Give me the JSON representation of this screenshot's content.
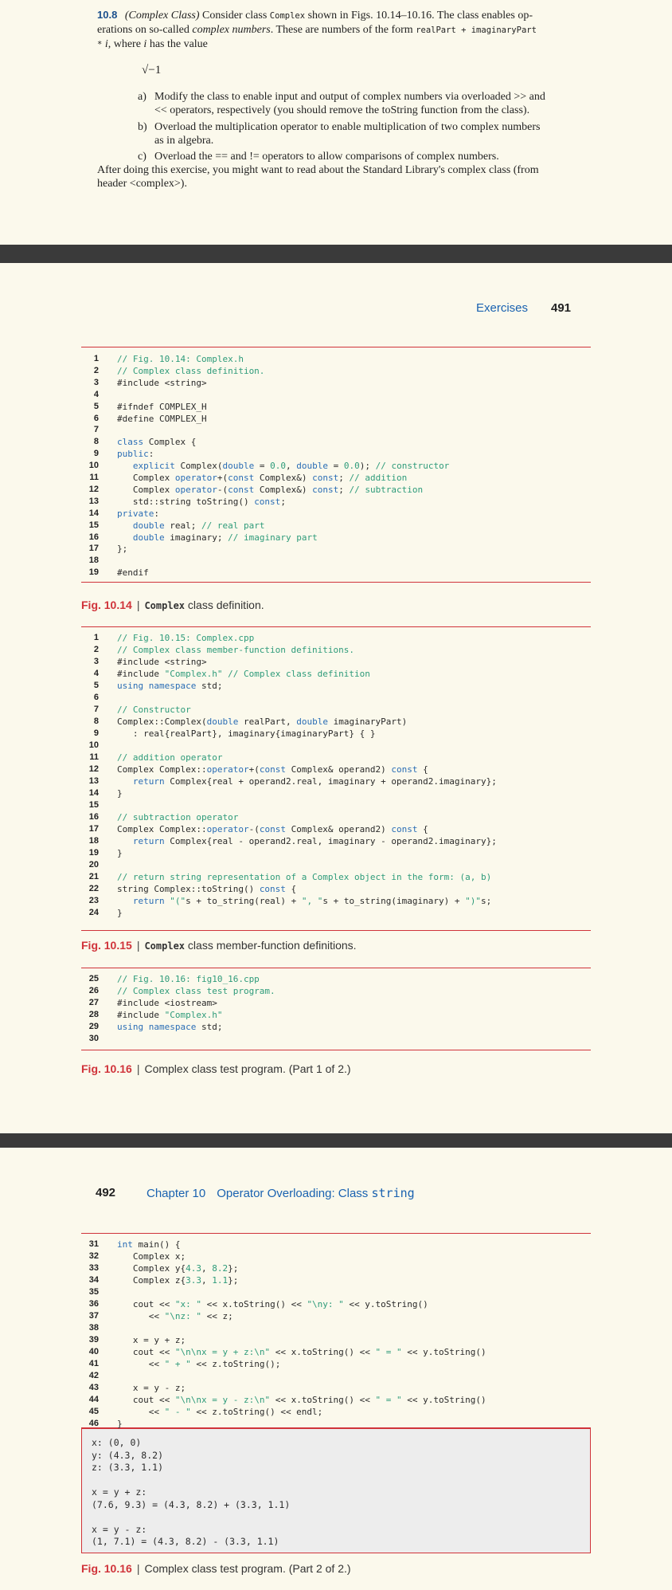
{
  "exercise": {
    "number": "10.8",
    "title": "(Complex Class)",
    "intro_a": " Consider class ",
    "intro_code": "Complex",
    "intro_b": " shown in Figs. 10.14–10.16. The class enables op-",
    "line2_a": "erations on so-called ",
    "line2_em": "complex numbers",
    "line2_b": ". These are numbers of the form ",
    "line2_code": "realPart + imaginaryPart",
    "line3_code": "*",
    "line3_a": " ",
    "line3_i": "i",
    "line3_b": ", where ",
    "line3_i2": "i",
    "line3_c": " has the value",
    "sqrt": "√−1",
    "item_a_label": "a)",
    "item_a_1": "Modify the class to enable input and output of complex numbers via overloaded >> and",
    "item_a_2": "<< operators, respectively (you should remove the toString function from the class).",
    "item_b_label": "b)",
    "item_b_1": "Overload the multiplication operator to enable multiplication of two complex numbers",
    "item_b_2": "as in algebra.",
    "item_c_label": "c)",
    "item_c": "Overload the == and != operators to allow comparisons of complex numbers.",
    "after_1": "After doing this exercise, you might want to read about the Standard Library's complex class (from",
    "after_2": "header <complex>)."
  },
  "page2": {
    "header_section": "Exercises",
    "header_page": "491"
  },
  "page3": {
    "header_page": "492",
    "header_chapter": "Chapter 10",
    "header_title": "Operator Overloading: Class ",
    "header_title_code": "string"
  },
  "fig1014": {
    "lines": [
      {
        "n": "1",
        "t": "// Fig. 10.14: Complex.h"
      },
      {
        "n": "2",
        "t": "// Complex class definition."
      },
      {
        "n": "3",
        "t": "#include <string>"
      },
      {
        "n": "4",
        "t": ""
      },
      {
        "n": "5",
        "t": "#ifndef COMPLEX_H"
      },
      {
        "n": "6",
        "t": "#define COMPLEX_H"
      },
      {
        "n": "7",
        "t": ""
      },
      {
        "n": "8",
        "t": "class Complex {"
      },
      {
        "n": "9",
        "t": "public:"
      },
      {
        "n": "10",
        "t": "   explicit Complex(double = 0.0, double = 0.0); // constructor"
      },
      {
        "n": "11",
        "t": "   Complex operator+(const Complex&) const; // addition"
      },
      {
        "n": "12",
        "t": "   Complex operator-(const Complex&) const; // subtraction"
      },
      {
        "n": "13",
        "t": "   std::string toString() const;"
      },
      {
        "n": "14",
        "t": "private:"
      },
      {
        "n": "15",
        "t": "   double real; // real part"
      },
      {
        "n": "16",
        "t": "   double imaginary; // imaginary part"
      },
      {
        "n": "17",
        "t": "};"
      },
      {
        "n": "18",
        "t": ""
      },
      {
        "n": "19",
        "t": "#endif"
      }
    ],
    "cap_fig": "Fig. 10.14",
    "cap_code": "Complex",
    "cap_text": " class definition."
  },
  "fig1015": {
    "lines": [
      {
        "n": "1",
        "t": "// Fig. 10.15: Complex.cpp"
      },
      {
        "n": "2",
        "t": "// Complex class member-function definitions."
      },
      {
        "n": "3",
        "t": "#include <string>"
      },
      {
        "n": "4",
        "t": "#include \"Complex.h\" // Complex class definition"
      },
      {
        "n": "5",
        "t": "using namespace std;"
      },
      {
        "n": "6",
        "t": ""
      },
      {
        "n": "7",
        "t": "// Constructor"
      },
      {
        "n": "8",
        "t": "Complex::Complex(double realPart, double imaginaryPart)"
      },
      {
        "n": "9",
        "t": "   : real{realPart}, imaginary{imaginaryPart} { }"
      },
      {
        "n": "10",
        "t": ""
      },
      {
        "n": "11",
        "t": "// addition operator"
      },
      {
        "n": "12",
        "t": "Complex Complex::operator+(const Complex& operand2) const {"
      },
      {
        "n": "13",
        "t": "   return Complex{real + operand2.real, imaginary + operand2.imaginary};"
      },
      {
        "n": "14",
        "t": "}"
      },
      {
        "n": "15",
        "t": ""
      },
      {
        "n": "16",
        "t": "// subtraction operator"
      },
      {
        "n": "17",
        "t": "Complex Complex::operator-(const Complex& operand2) const {"
      },
      {
        "n": "18",
        "t": "   return Complex{real - operand2.real, imaginary - operand2.imaginary};"
      },
      {
        "n": "19",
        "t": "}"
      },
      {
        "n": "20",
        "t": ""
      },
      {
        "n": "21",
        "t": "// return string representation of a Complex object in the form: (a, b)"
      },
      {
        "n": "22",
        "t": "string Complex::toString() const {"
      },
      {
        "n": "23",
        "t": "   return \"(\"s + to_string(real) + \", \"s + to_string(imaginary) + \")\"s;"
      },
      {
        "n": "24",
        "t": "}"
      }
    ],
    "cap_fig": "Fig. 10.15",
    "cap_code": "Complex",
    "cap_text": " class member-function definitions."
  },
  "fig1016a": {
    "lines": [
      {
        "n": "25",
        "t": "// Fig. 10.16: fig10_16.cpp"
      },
      {
        "n": "26",
        "t": "// Complex class test program."
      },
      {
        "n": "27",
        "t": "#include <iostream>"
      },
      {
        "n": "28",
        "t": "#include \"Complex.h\""
      },
      {
        "n": "29",
        "t": "using namespace std;"
      },
      {
        "n": "30",
        "t": ""
      }
    ],
    "cap_fig": "Fig. 10.16",
    "cap_text": "Complex class test program. (Part 1 of 2.)"
  },
  "fig1016b": {
    "lines": [
      {
        "n": "31",
        "t": "int main() {"
      },
      {
        "n": "32",
        "t": "   Complex x;"
      },
      {
        "n": "33",
        "t": "   Complex y{4.3, 8.2};"
      },
      {
        "n": "34",
        "t": "   Complex z{3.3, 1.1};"
      },
      {
        "n": "35",
        "t": ""
      },
      {
        "n": "36",
        "t": "   cout << \"x: \" << x.toString() << \"\\ny: \" << y.toString()"
      },
      {
        "n": "37",
        "t": "      << \"\\nz: \" << z;"
      },
      {
        "n": "38",
        "t": ""
      },
      {
        "n": "39",
        "t": "   x = y + z;"
      },
      {
        "n": "40",
        "t": "   cout << \"\\n\\nx = y + z:\\n\" << x.toString() << \" = \" << y.toString()"
      },
      {
        "n": "41",
        "t": "      << \" + \" << z.toString();"
      },
      {
        "n": "42",
        "t": ""
      },
      {
        "n": "43",
        "t": "   x = y - z;"
      },
      {
        "n": "44",
        "t": "   cout << \"\\n\\nx = y - z:\\n\" << x.toString() << \" = \" << y.toString()"
      },
      {
        "n": "45",
        "t": "      << \" - \" << z.toString() << endl;"
      },
      {
        "n": "46",
        "t": "}"
      }
    ],
    "output": [
      "x: (0, 0)",
      "y: (4.3, 8.2)",
      "z: (3.3, 1.1)",
      "",
      "x = y + z:",
      "(7.6, 9.3) = (4.3, 8.2) + (3.3, 1.1)",
      "",
      "x = y - z:",
      "(1, 7.1) = (4.3, 8.2) - (3.3, 1.1)"
    ],
    "cap_fig": "Fig. 10.16",
    "cap_text": "Complex class test program. (Part 2 of 2.)"
  }
}
